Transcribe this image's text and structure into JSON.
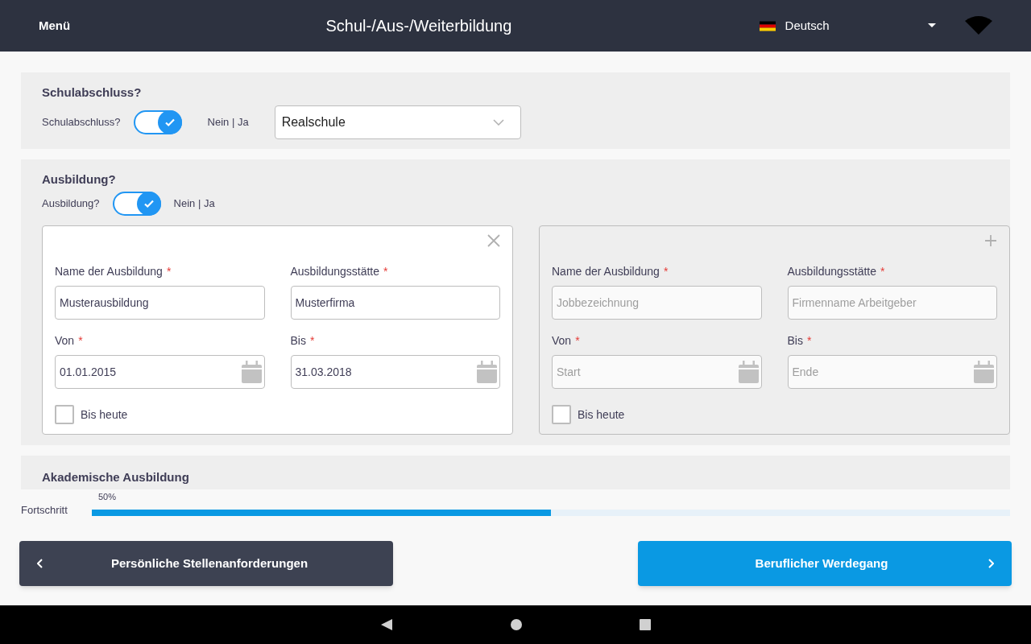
{
  "header": {
    "menu": "Menü",
    "title": "Schul-/Aus-/Weiterbildung",
    "language": "Deutsch"
  },
  "school": {
    "heading": "Schulabschluss?",
    "toggle_label": "Schulabschluss?",
    "on": true,
    "toggle_hint": "Nein | Ja",
    "select_value": "Realschule"
  },
  "training": {
    "heading": "Ausbildung?",
    "toggle_label": "Ausbildung?",
    "on": true,
    "toggle_hint": "Nein | Ja",
    "entries": [
      {
        "kind": "entry",
        "fields": [
          {
            "kind": "text",
            "label": "Name der Ausbildung",
            "required_mark": "*",
            "value": "Musterausbildung"
          },
          {
            "kind": "text",
            "label": "Ausbildungsstätte",
            "required_mark": "*",
            "value": "Musterfirma"
          },
          {
            "kind": "date",
            "label": "Von",
            "required_mark": "*",
            "value": "01.01.2015"
          },
          {
            "kind": "date",
            "label": "Bis",
            "required_mark": "*",
            "value": "31.03.2018"
          }
        ],
        "checkbox": {
          "label": "Bis heute",
          "checked": false
        }
      },
      {
        "kind": "new",
        "fields": [
          {
            "kind": "text",
            "label": "Name der Ausbildung",
            "required_mark": "*",
            "placeholder": "Jobbezeichnung"
          },
          {
            "kind": "text",
            "label": "Ausbildungsstätte",
            "required_mark": "*",
            "placeholder": "Firmenname Arbeitgeber"
          },
          {
            "kind": "date",
            "label": "Von",
            "required_mark": "*",
            "placeholder": "Start"
          },
          {
            "kind": "date",
            "label": "Bis",
            "required_mark": "*",
            "placeholder": "Ende"
          }
        ],
        "checkbox": {
          "label": "Bis heute",
          "checked": false
        }
      }
    ]
  },
  "academic": {
    "heading": "Akademische Ausbildung"
  },
  "progress": {
    "label": "Fortschritt",
    "reading": "50%",
    "level": 0.5
  },
  "nav": {
    "back": "Persönliche Stellenanforderungen",
    "next": "Beruflicher Werdegang"
  }
}
